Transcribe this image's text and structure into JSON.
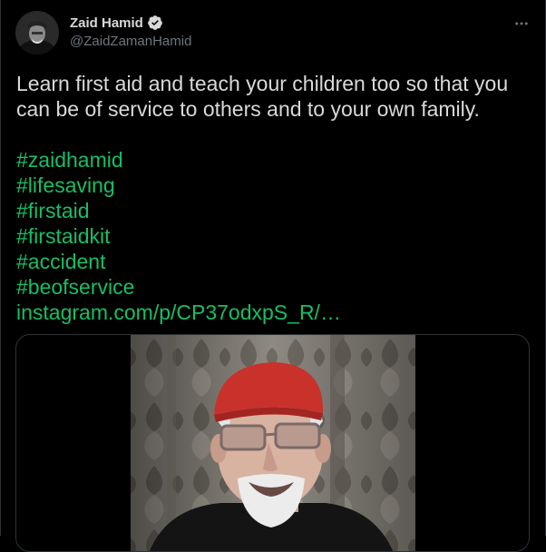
{
  "author": {
    "display_name": "Zaid Hamid",
    "handle": "@ZaidZamanHamid",
    "verified": true,
    "avatar_icon": "profile-photo"
  },
  "tweet": {
    "text": "Learn first aid and teach your children too so that you can be of service to others  and to your own family.",
    "links": [
      "#zaidhamid",
      "#lifesaving",
      "#firstaid",
      "#firstaidkit",
      "#accident",
      "#beofservice",
      "instagram.com/p/CP37odxpS_R/…"
    ]
  },
  "media": {
    "type": "video",
    "icon": "video-thumbnail"
  },
  "colors": {
    "background": "#000000",
    "link": "#17bf63",
    "text": "#d9d9d9",
    "secondary_text": "#6e767d",
    "verified": "#d9d9d9"
  }
}
